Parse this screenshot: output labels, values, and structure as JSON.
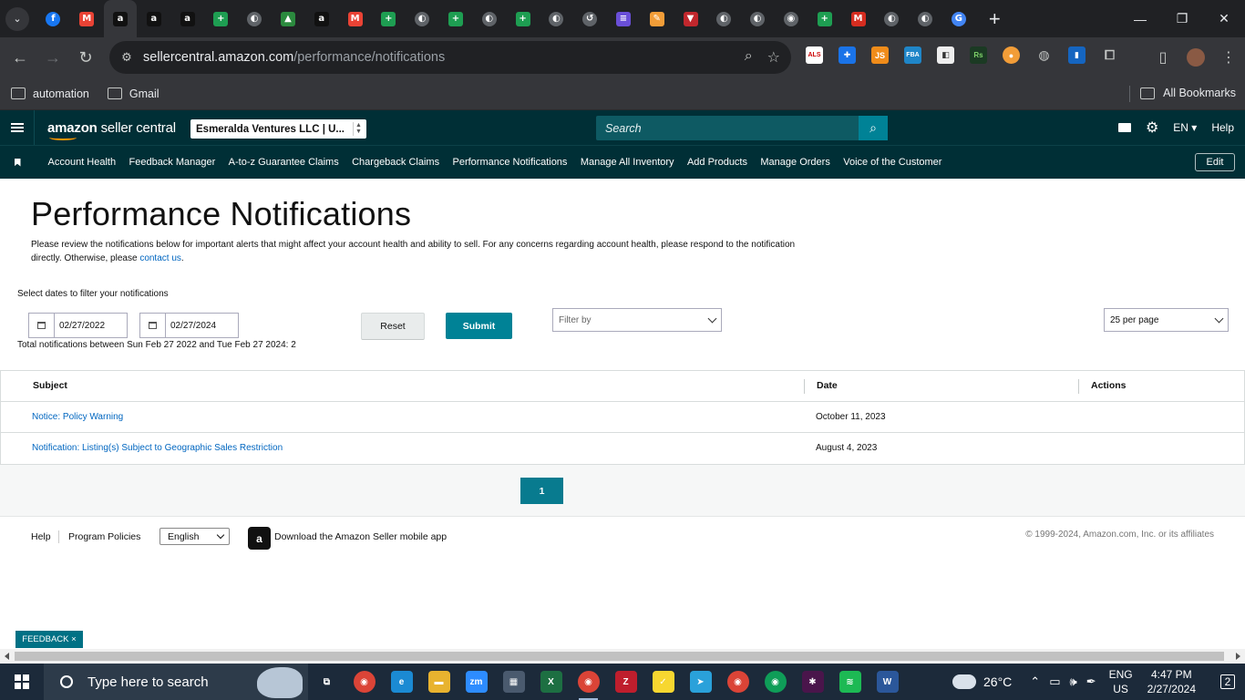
{
  "browser": {
    "tabs": [
      {
        "icon": "facebook-icon",
        "glyph": "f",
        "color": "#1877f2",
        "shape": "circle"
      },
      {
        "icon": "gmail-icon",
        "glyph": "M",
        "color": "#ea4335",
        "shape": "square"
      },
      {
        "icon": "amazon-icon",
        "glyph": "a",
        "color": "#111111",
        "shape": "square",
        "active": true
      },
      {
        "icon": "amazon-icon",
        "glyph": "a",
        "color": "#111111",
        "shape": "square"
      },
      {
        "icon": "amazon-icon",
        "glyph": "a",
        "color": "#111111",
        "shape": "square"
      },
      {
        "icon": "sheets-plus-icon",
        "glyph": "+",
        "color": "#1e9e52",
        "shape": "square"
      },
      {
        "icon": "globe-icon",
        "glyph": "◐",
        "color": "#5f6368",
        "shape": "circle"
      },
      {
        "icon": "drive-icon",
        "glyph": "▲",
        "color": "#2b8a3e",
        "shape": "square"
      },
      {
        "icon": "amazon-icon",
        "glyph": "a",
        "color": "#111111",
        "shape": "square"
      },
      {
        "icon": "gmail-icon",
        "glyph": "M",
        "color": "#ea4335",
        "shape": "square"
      },
      {
        "icon": "sheets-plus-icon",
        "glyph": "+",
        "color": "#1e9e52",
        "shape": "square"
      },
      {
        "icon": "globe-icon",
        "glyph": "◐",
        "color": "#5f6368",
        "shape": "circle"
      },
      {
        "icon": "sheets-plus-icon",
        "glyph": "+",
        "color": "#1e9e52",
        "shape": "square"
      },
      {
        "icon": "globe-icon",
        "glyph": "◐",
        "color": "#5f6368",
        "shape": "circle"
      },
      {
        "icon": "sheets-plus-icon",
        "glyph": "+",
        "color": "#1e9e52",
        "shape": "square"
      },
      {
        "icon": "globe-icon",
        "glyph": "◐",
        "color": "#5f6368",
        "shape": "circle"
      },
      {
        "icon": "history-icon",
        "glyph": "↺",
        "color": "#5f6368",
        "shape": "circle"
      },
      {
        "icon": "list-icon",
        "glyph": "≡",
        "color": "#6a4fd8",
        "shape": "square"
      },
      {
        "icon": "pen-icon",
        "glyph": "✎",
        "color": "#f29d38",
        "shape": "square"
      },
      {
        "icon": "red-flag-icon",
        "glyph": "▼",
        "color": "#c1272d",
        "shape": "square"
      },
      {
        "icon": "globe-icon",
        "glyph": "◐",
        "color": "#5f6368",
        "shape": "circle"
      },
      {
        "icon": "globe-icon",
        "glyph": "◐",
        "color": "#5f6368",
        "shape": "circle"
      },
      {
        "icon": "chrome-icon",
        "glyph": "◉",
        "color": "#5f6368",
        "shape": "circle"
      },
      {
        "icon": "sheets-plus-icon",
        "glyph": "+",
        "color": "#1e9e52",
        "shape": "square"
      },
      {
        "icon": "m-red-icon",
        "glyph": "M",
        "color": "#d62d20",
        "shape": "square"
      },
      {
        "icon": "globe-icon",
        "glyph": "◐",
        "color": "#5f6368",
        "shape": "circle"
      },
      {
        "icon": "globe-icon",
        "glyph": "◐",
        "color": "#5f6368",
        "shape": "circle"
      },
      {
        "icon": "google-icon",
        "glyph": "G",
        "color": "#4285f4",
        "shape": "circle"
      }
    ],
    "url_host": "sellercentral.amazon.com",
    "url_path": "/performance/notifications",
    "bookmarks": [
      "automation",
      "Gmail"
    ],
    "all_bookmarks": "All Bookmarks"
  },
  "header": {
    "logo_bold": "amazon",
    "logo_rest": " seller central",
    "account": "Esmeralda Ventures LLC | U...",
    "search_placeholder": "Search",
    "language": "EN ▾",
    "help": "Help"
  },
  "nav": {
    "items": [
      "Account Health",
      "Feedback Manager",
      "A-to-z Guarantee Claims",
      "Chargeback Claims",
      "Performance Notifications",
      "Manage All Inventory",
      "Add Products",
      "Manage Orders",
      "Voice of the Customer"
    ],
    "edit": "Edit"
  },
  "page": {
    "title": "Performance Notifications",
    "desc_1": "Please review the notifications below for important alerts that might affect your account health and ability to sell. For any concerns regarding account health, please respond to the notification directly. Otherwise, please ",
    "desc_link": "contact us",
    "desc_2": ".",
    "filter_label": "Select dates to filter your notifications",
    "date_from": "02/27/2022",
    "date_to": "02/27/2024",
    "reset": "Reset",
    "submit": "Submit",
    "filter_by": "Filter by",
    "per_page": "25 per page",
    "total": "Total notifications between Sun Feb 27 2022 and Tue Feb 27 2024: 2"
  },
  "table": {
    "headers": {
      "subject": "Subject",
      "date": "Date",
      "actions": "Actions"
    },
    "rows": [
      {
        "subject": "Notice: Policy Warning",
        "date": "October 11, 2023"
      },
      {
        "subject": "Notification: Listing(s) Subject to Geographic Sales Restriction",
        "date": "August 4, 2023"
      }
    ],
    "page": "1"
  },
  "footer": {
    "help": "Help",
    "policies": "Program Policies",
    "language": "English",
    "app": "Download the Amazon Seller mobile app",
    "copyright": "© 1999-2024, Amazon.com, Inc. or its affiliates"
  },
  "feedback": "FEEDBACK ×",
  "taskbar": {
    "search": "Type here to search",
    "weather": "26°C",
    "lang_1": "ENG",
    "lang_2": "US",
    "time": "4:47 PM",
    "date": "2/27/2024",
    "notifications": "2",
    "apps": [
      {
        "icon": "task-view-icon",
        "glyph": "⧉",
        "color": "transparent"
      },
      {
        "icon": "chrome-profile-icon",
        "glyph": "◉",
        "color": "#db4437"
      },
      {
        "icon": "edge-icon",
        "glyph": "e",
        "color": "#1b8ad3"
      },
      {
        "icon": "file-explorer-icon",
        "glyph": "▬",
        "color": "#e8b32f"
      },
      {
        "icon": "zoom-icon",
        "glyph": "zm",
        "color": "#2d8cff"
      },
      {
        "icon": "calculator-icon",
        "glyph": "▦",
        "color": "#4a5a6e"
      },
      {
        "icon": "excel-icon",
        "glyph": "X",
        "color": "#1d6f42"
      },
      {
        "icon": "chrome-icon",
        "glyph": "◉",
        "color": "#db4437",
        "active": true
      },
      {
        "icon": "filezilla-icon",
        "glyph": "Z",
        "color": "#bf1e2d"
      },
      {
        "icon": "sticky-notes-icon",
        "glyph": "✓",
        "color": "#f7d730"
      },
      {
        "icon": "telegram-icon",
        "glyph": "➤",
        "color": "#2aa1da"
      },
      {
        "icon": "chrome-icon",
        "glyph": "◉",
        "color": "#db4437"
      },
      {
        "icon": "chrome-icon",
        "glyph": "◉",
        "color": "#0f9d58"
      },
      {
        "icon": "slack-icon",
        "glyph": "✱",
        "color": "#4a154b"
      },
      {
        "icon": "spotify-icon",
        "glyph": "≋",
        "color": "#1db954"
      },
      {
        "icon": "word-icon",
        "glyph": "W",
        "color": "#2b579a"
      }
    ]
  }
}
